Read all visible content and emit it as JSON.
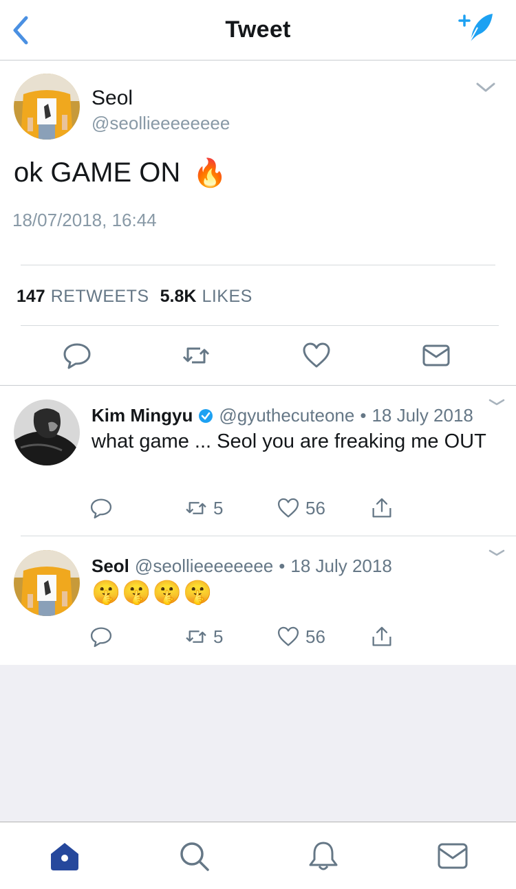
{
  "header": {
    "title": "Tweet",
    "back_icon": "chevron-left-icon",
    "compose_icon": "compose-feather-icon"
  },
  "main_tweet": {
    "name": "Seol",
    "handle": "@seollieeeeeeee",
    "text": "ok GAME ON",
    "emoji": "🔥",
    "timestamp": "18/07/2018, 16:44",
    "retweets_count": "147",
    "retweets_label": "RETWEETS",
    "likes_count": "5.8K",
    "likes_label": "LIKES",
    "actions": [
      "reply-icon",
      "retweet-icon",
      "heart-icon",
      "mail-icon"
    ]
  },
  "replies": [
    {
      "name": "Kim Mingyu",
      "verified": true,
      "handle": "@gyuthecuteone",
      "separator": "•",
      "date": "18 July 2018",
      "text": "what game ... Seol you are freaking me OUT",
      "retweets": "5",
      "likes": "56"
    },
    {
      "name": "Seol",
      "verified": false,
      "handle": "@seollieeeeeeee",
      "separator": "•",
      "date": "18 July 2018",
      "text": "🤫🤫🤫🤫",
      "retweets": "5",
      "likes": "56"
    }
  ],
  "tabbar": {
    "items": [
      "home-icon",
      "search-icon",
      "notifications-bell-icon",
      "messages-mail-icon"
    ],
    "active": "home-icon"
  },
  "colors": {
    "accent": "#1da1f2",
    "back_blue": "#4a90e2",
    "secondary_text": "#657786",
    "muted_text": "#8899a6",
    "active_tab": "#26489c",
    "empty_bg": "#efeff4"
  }
}
